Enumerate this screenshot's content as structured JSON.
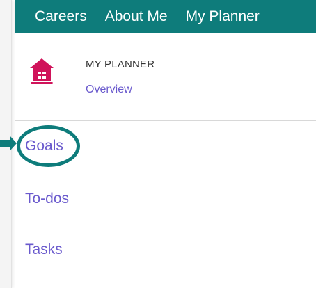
{
  "topnav": {
    "items": [
      "Careers",
      "About Me",
      "My Planner"
    ]
  },
  "header": {
    "icon": "home-icon",
    "title": "MY PLANNER",
    "link": "Overview"
  },
  "menu": {
    "items": [
      "Goals",
      "To-dos",
      "Tasks"
    ]
  },
  "colors": {
    "nav_bg": "#0e7c7b",
    "link": "#6a5acd",
    "icon": "#d0135a",
    "highlight": "#0e7c7b"
  }
}
